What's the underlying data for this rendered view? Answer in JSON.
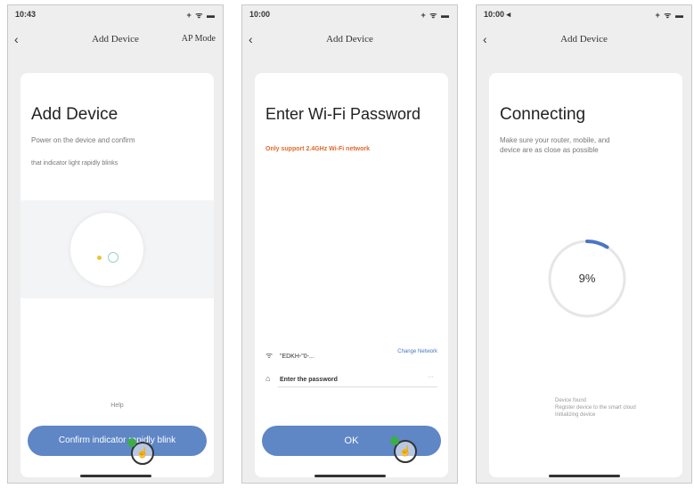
{
  "screens": [
    {
      "status_time": "10:43",
      "status_icons": "+ ᯤ ▬",
      "nav_title": "Add Device",
      "nav_right": "AP Mode",
      "heading": "Add Device",
      "subtitle1": "Power on the device and confirm",
      "subtitle2": "that indicator light rapidly blinks",
      "help": "Help",
      "button": "Confirm indicator rapidly blink"
    },
    {
      "status_time": "10:00",
      "status_icons": "+ ᯤ ▬",
      "nav_title": "Add Device",
      "heading": "Enter Wi-Fi Password",
      "warning": "Only support 2.4GHz Wi-Fi network",
      "wifi_name": "\"EDKH-\"0-...",
      "change_network": "Change Network",
      "password_placeholder": "Enter the password",
      "password_more": "···",
      "button": "OK"
    },
    {
      "status_time": "10:00 ◂",
      "status_icons": "+ ᯤ ▬",
      "nav_title": "Add Device",
      "heading": "Connecting",
      "subtitle1": "Make sure your router, mobile, and",
      "subtitle2": "device are as close as possible",
      "progress_text": "9%",
      "progress_value": 0.09,
      "step1": "Device found",
      "step2": "Register device to the smart cloud",
      "step3": "Initializing device"
    }
  ],
  "icons": {
    "back": "‹",
    "wifi": "ᯤ",
    "lock": "⌂",
    "hand": "☝"
  },
  "colors": {
    "button": "#5f86c5",
    "warning": "#e06a2c",
    "progress": "#4a76c2",
    "tap_dot": "#3cad4a"
  }
}
